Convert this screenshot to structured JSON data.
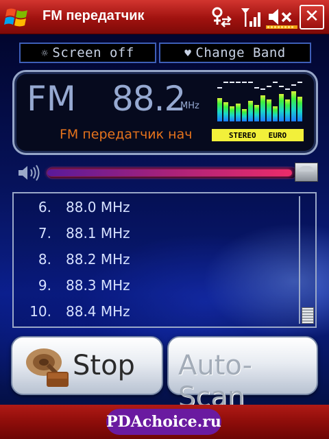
{
  "window": {
    "title": "FM передатчик",
    "close_label": "✕"
  },
  "status_icons": [
    "connectivity-icon",
    "signal-icon",
    "volume-muted-icon",
    "battery-icon"
  ],
  "toolbar": {
    "screen_off_label": "Screen off",
    "change_band_label": "Change Band"
  },
  "display": {
    "band": "FM",
    "frequency": "88.2",
    "unit": "MHz",
    "station_text": "FM передатчик нач",
    "stereo_label": "STEREO",
    "region_label": "EURO"
  },
  "volume": {
    "level": 0.98
  },
  "presets": [
    {
      "index": "6.",
      "frequency": "88.0 MHz"
    },
    {
      "index": "7.",
      "frequency": "88.1 MHz"
    },
    {
      "index": "8.",
      "frequency": "88.2 MHz"
    },
    {
      "index": "9.",
      "frequency": "88.3 MHz"
    },
    {
      "index": "10.",
      "frequency": "88.4 MHz"
    }
  ],
  "actions": {
    "stop_label": "Stop",
    "auto_scan_label": "Auto-Scan"
  },
  "footer": {
    "watermark": "PDAchoice.ru"
  },
  "colors": {
    "title_bar": "#a0120f",
    "station_text": "#e6731c",
    "stereo_badge": "#f2f03a",
    "digits": "#96a9d1",
    "volume_fill": "#ec2c6a"
  }
}
